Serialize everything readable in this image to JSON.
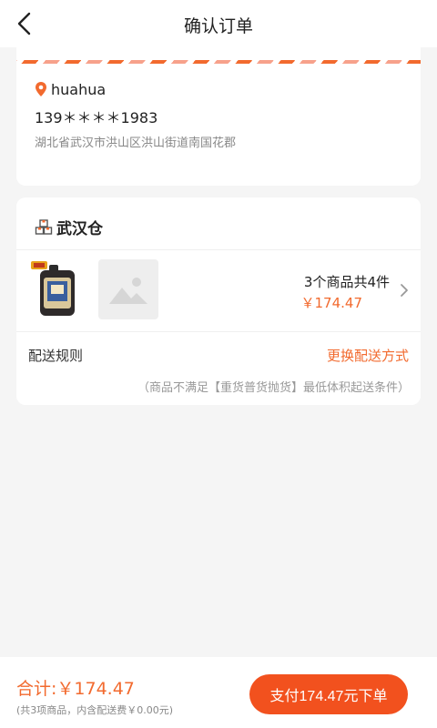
{
  "header": {
    "title": "确认订单",
    "back_icon": "chevron-left-icon"
  },
  "address": {
    "name": "huahua",
    "phone": "139＊＊＊＊1983",
    "detail": "湖北省武汉市洪山区洪山街道南国花郡",
    "pin_icon": "location-pin-icon",
    "accent_color": "#f26a2e"
  },
  "warehouse": {
    "name": "武汉仓",
    "icon": "warehouse-boxes-icon",
    "goods_summary": "3个商品共4件",
    "goods_price": "￥174.47",
    "delivery_rule_label": "配送规则",
    "delivery_change_link": "更换配送方式",
    "delivery_note": "（商品不满足【重货普货抛货】最低体积起送条件）"
  },
  "footer": {
    "total": "合计:￥174.47",
    "total_note": "(共3项商品，内含配送费￥0.00元)",
    "pay_button": "支付174.47元下单",
    "button_color": "#f2511e"
  }
}
